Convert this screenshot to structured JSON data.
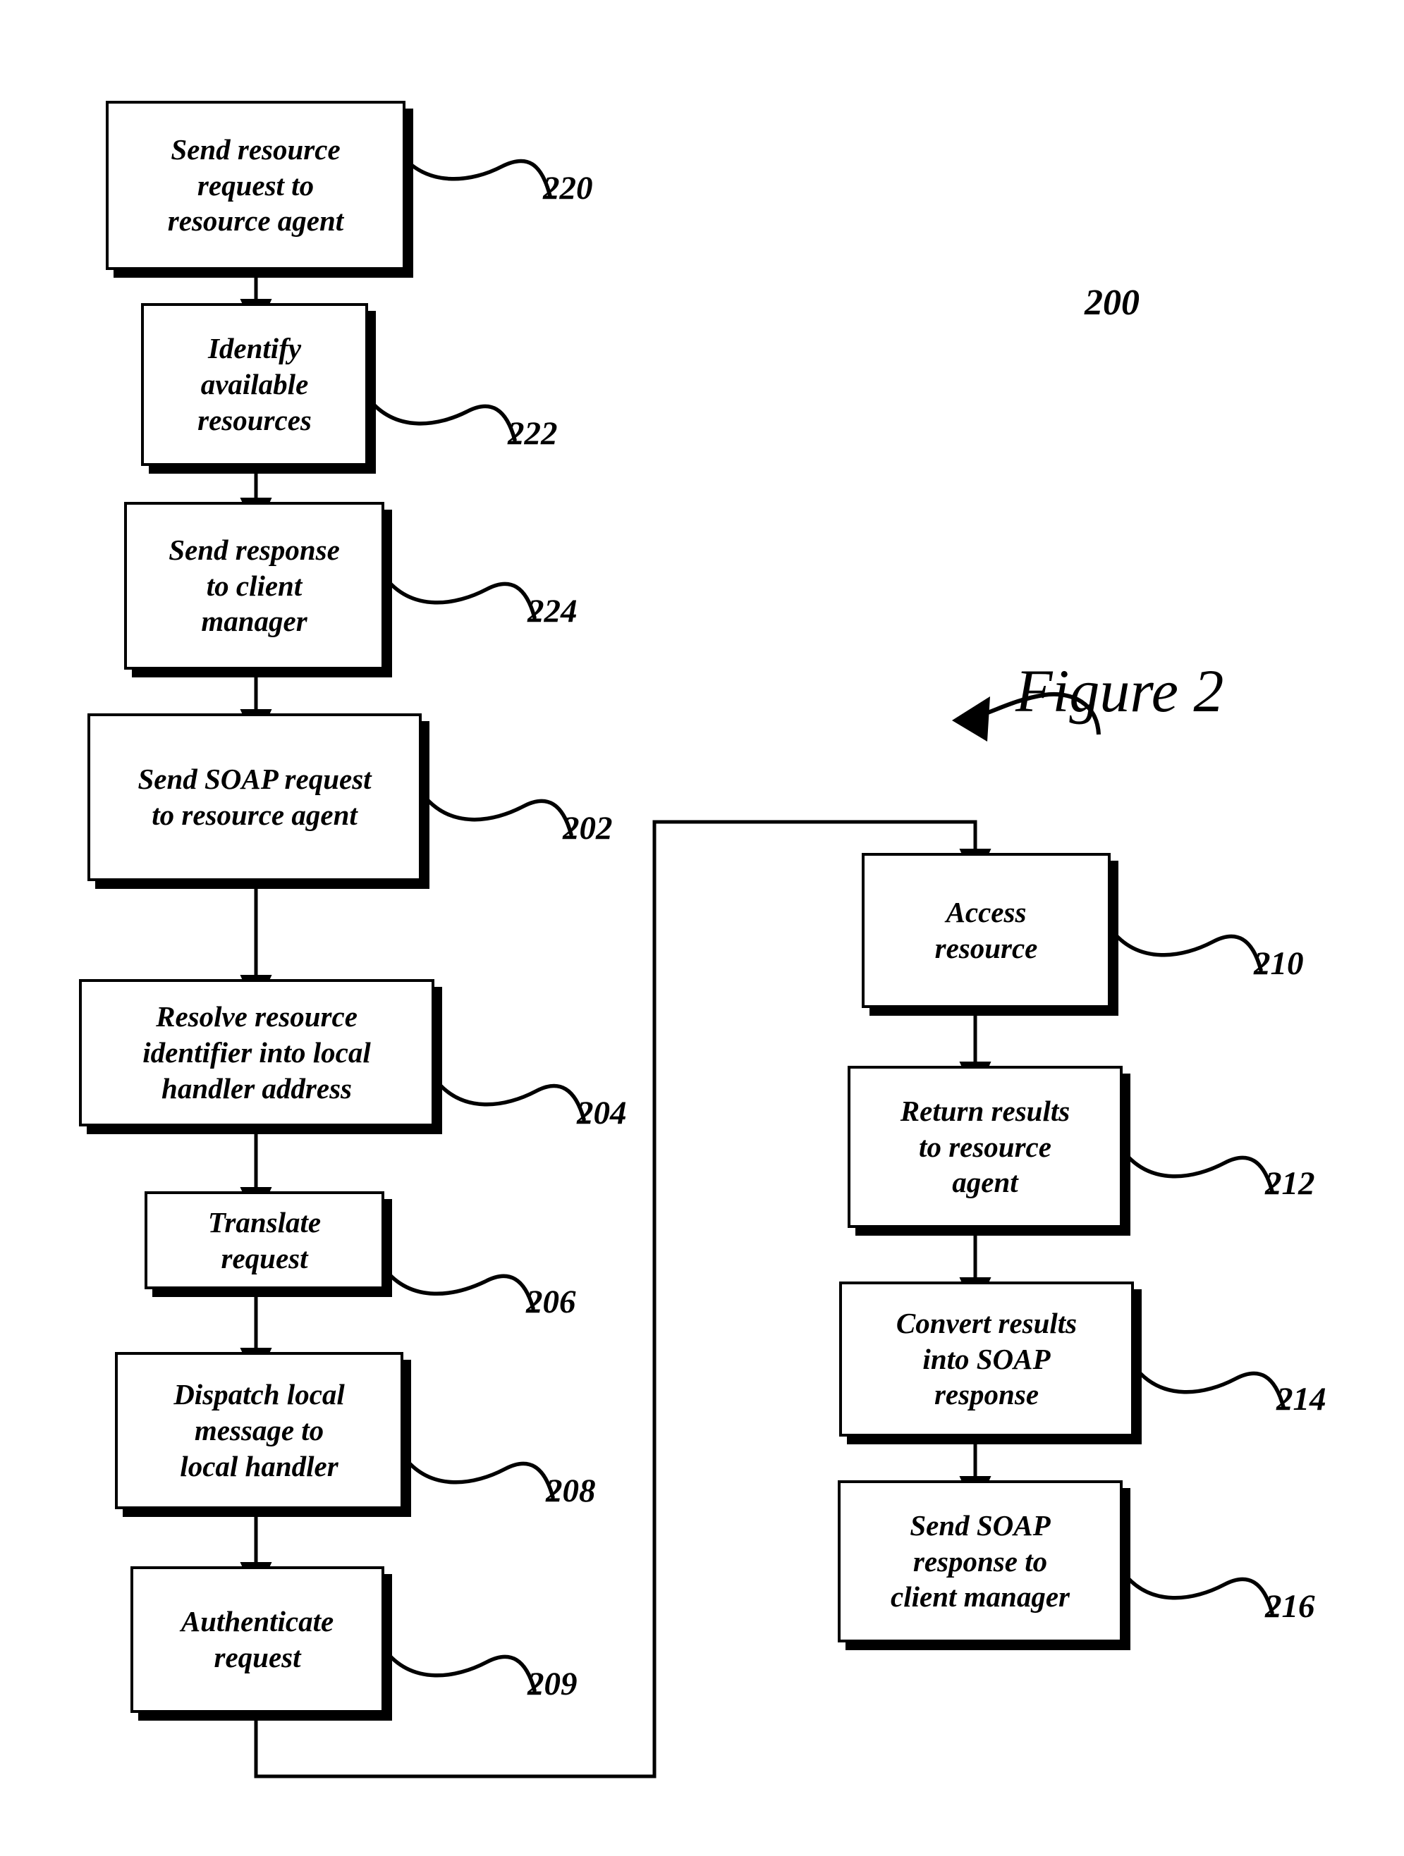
{
  "figure": {
    "caption": "Figure 2",
    "diagram_ref": "200"
  },
  "colors": {
    "ink": "#000000",
    "paper": "#ffffff"
  },
  "nodes": [
    {
      "id": "n220",
      "label": "Send resource\nrequest to\nresource agent",
      "ref": "220"
    },
    {
      "id": "n222",
      "label": "Identify\navailable\nresources",
      "ref": "222"
    },
    {
      "id": "n224",
      "label": "Send response\nto client\nmanager",
      "ref": "224"
    },
    {
      "id": "n202",
      "label": "Send SOAP request\nto resource agent",
      "ref": "202"
    },
    {
      "id": "n204",
      "label": "Resolve resource\nidentifier into local\nhandler address",
      "ref": "204"
    },
    {
      "id": "n206",
      "label": "Translate\nrequest",
      "ref": "206"
    },
    {
      "id": "n208",
      "label": "Dispatch local\nmessage to\nlocal handler",
      "ref": "208"
    },
    {
      "id": "n209",
      "label": "Authenticate\nrequest",
      "ref": "209"
    },
    {
      "id": "n210",
      "label": "Access\nresource",
      "ref": "210"
    },
    {
      "id": "n212",
      "label": "Return results\nto resource\nagent",
      "ref": "212"
    },
    {
      "id": "n214",
      "label": "Convert results\ninto SOAP\nresponse",
      "ref": "214"
    },
    {
      "id": "n216",
      "label": "Send SOAP\nresponse to\nclient manager",
      "ref": "216"
    }
  ],
  "flow": {
    "left_column_order": [
      "n220",
      "n222",
      "n224",
      "n202",
      "n204",
      "n206",
      "n208",
      "n209"
    ],
    "right_column_order": [
      "n210",
      "n212",
      "n214",
      "n216"
    ],
    "crossover": "n209 -> n210"
  }
}
